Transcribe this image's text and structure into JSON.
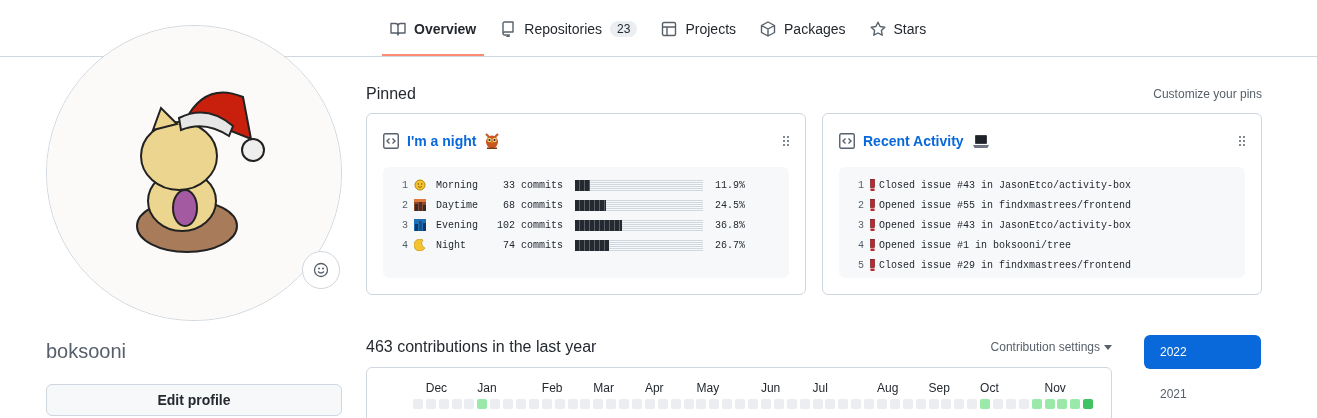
{
  "tabs": [
    {
      "label": "Overview",
      "selected": true
    },
    {
      "label": "Repositories",
      "count": "23",
      "selected": false
    },
    {
      "label": "Projects",
      "selected": false
    },
    {
      "label": "Packages",
      "selected": false
    },
    {
      "label": "Stars",
      "selected": false
    }
  ],
  "profile": {
    "username": "boksooni",
    "edit_button": "Edit profile"
  },
  "pinned": {
    "title": "Pinned",
    "customize_link": "Customize your pins",
    "cards": [
      {
        "kind": "commit-stats",
        "title": "I'm a night",
        "rows": [
          {
            "line": "1",
            "label": "Morning",
            "commits": "33 commits",
            "level": 0.119,
            "percent": "11.9%"
          },
          {
            "line": "2",
            "label": "Daytime",
            "commits": "68 commits",
            "level": 0.245,
            "percent": "24.5%"
          },
          {
            "line": "3",
            "label": "Evening",
            "commits": "102 commits",
            "level": 0.368,
            "percent": "36.8%"
          },
          {
            "line": "4",
            "label": "Night",
            "commits": "74 commits",
            "level": 0.267,
            "percent": "26.7%"
          }
        ]
      },
      {
        "kind": "activity",
        "title": "Recent Activity",
        "rows": [
          {
            "line": "1",
            "text": "Closed issue #43 in JasonEtco/activity-box"
          },
          {
            "line": "2",
            "text": "Opened issue #55 in findxmastrees/frontend"
          },
          {
            "line": "3",
            "text": "Opened issue #43 in JasonEtco/activity-box"
          },
          {
            "line": "4",
            "text": "Opened issue #1 in boksooni/tree"
          },
          {
            "line": "5",
            "text": "Closed issue #29 in findxmastrees/frontend"
          }
        ]
      }
    ]
  },
  "contributions": {
    "heading": "463 contributions in the last year",
    "settings": "Contribution settings",
    "months": [
      "Dec",
      "Jan",
      "Feb",
      "Mar",
      "Apr",
      "May",
      "Jun",
      "Jul",
      "Aug",
      "Sep",
      "Oct",
      "Nov"
    ],
    "rows": [
      {
        "cells": [
          {
            "color": "#ebedf0"
          },
          {
            "color": "#ebedf0"
          },
          {
            "color": "#ebedf0"
          },
          {
            "color": "#ebedf0"
          },
          {
            "color": "#ebedf0"
          },
          {
            "color": "#9be9a8"
          },
          {
            "color": "#ebedf0"
          },
          {
            "color": "#ebedf0"
          },
          {
            "color": "#ebedf0"
          },
          {
            "color": "#ebedf0"
          },
          {
            "color": "#ebedf0"
          },
          {
            "color": "#ebedf0"
          },
          {
            "color": "#ebedf0"
          },
          {
            "color": "#ebedf0"
          },
          {
            "color": "#ebedf0"
          },
          {
            "color": "#ebedf0"
          },
          {
            "color": "#ebedf0"
          },
          {
            "color": "#ebedf0"
          },
          {
            "color": "#ebedf0"
          },
          {
            "color": "#ebedf0"
          },
          {
            "color": "#ebedf0"
          },
          {
            "color": "#ebedf0"
          },
          {
            "color": "#ebedf0"
          },
          {
            "color": "#ebedf0"
          },
          {
            "color": "#ebedf0"
          },
          {
            "color": "#ebedf0"
          },
          {
            "color": "#ebedf0"
          },
          {
            "color": "#ebedf0"
          },
          {
            "color": "#ebedf0"
          },
          {
            "color": "#ebedf0"
          },
          {
            "color": "#ebedf0"
          },
          {
            "color": "#ebedf0"
          },
          {
            "color": "#ebedf0"
          },
          {
            "color": "#ebedf0"
          },
          {
            "color": "#ebedf0"
          },
          {
            "color": "#ebedf0"
          },
          {
            "color": "#ebedf0"
          },
          {
            "color": "#ebedf0"
          },
          {
            "color": "#ebedf0"
          },
          {
            "color": "#ebedf0"
          },
          {
            "color": "#ebedf0"
          },
          {
            "color": "#ebedf0"
          },
          {
            "color": "#ebedf0"
          },
          {
            "color": "#ebedf0"
          },
          {
            "color": "#9be9a8"
          },
          {
            "color": "#ebedf0"
          },
          {
            "color": "#ebedf0"
          },
          {
            "color": "#ebedf0"
          },
          {
            "color": "#9be9a8"
          },
          {
            "color": "#9be9a8"
          },
          {
            "color": "#9be9a8"
          },
          {
            "color": "#9be9a8"
          },
          {
            "color": "#40c463"
          }
        ]
      }
    ]
  },
  "years": [
    {
      "label": "2022",
      "selected": true
    },
    {
      "label": "2021",
      "selected": false
    }
  ]
}
